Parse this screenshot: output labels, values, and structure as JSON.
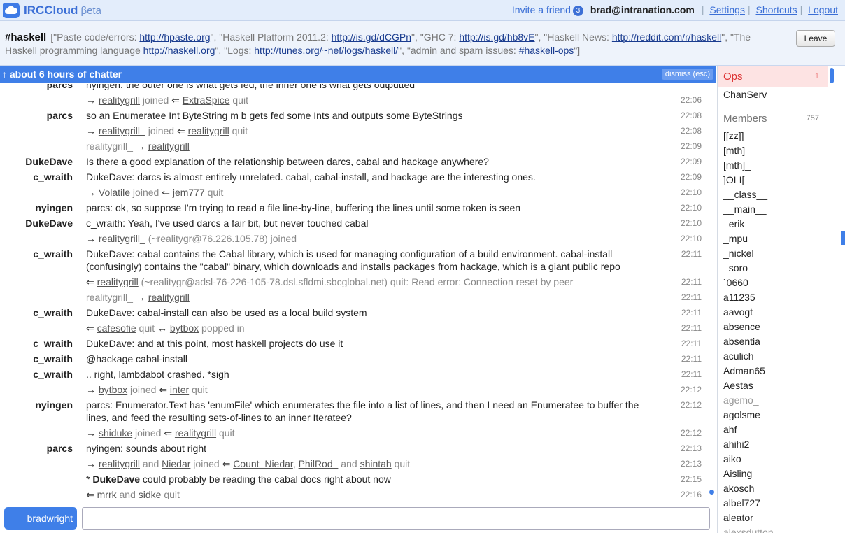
{
  "app": {
    "brand": "IRCCloud",
    "beta": "βeta"
  },
  "header": {
    "invite_label": "Invite a friend",
    "invite_count": "3",
    "user_email": "brad@intranation.com",
    "settings": "Settings",
    "shortcuts": "Shortcuts",
    "logout": "Logout"
  },
  "channel": {
    "name": "#haskell",
    "topic": [
      {
        "t": "[\"Paste code/errors: "
      },
      {
        "l": "http://hpaste.org"
      },
      {
        "t": "\", \"Haskell Platform 2011.2: "
      },
      {
        "l": "http://is.gd/dCGPn"
      },
      {
        "t": "\", \"GHC 7: "
      },
      {
        "l": "http://is.gd/hb8vE"
      },
      {
        "t": "\", \"Haskell News: "
      },
      {
        "l": "http://reddit.com/r/haskell"
      },
      {
        "t": "\", \"The Haskell programming language "
      },
      {
        "l": "http://haskell.org"
      },
      {
        "t": "\", \"Logs: "
      },
      {
        "l": "http://tunes.org/~nef/logs/haskell/"
      },
      {
        "t": "\", \"admin and spam issues: "
      },
      {
        "l": "#haskell-ops"
      },
      {
        "t": "\"]"
      }
    ],
    "leave_label": "Leave"
  },
  "chatter": {
    "label": "↑ about 6 hours of chatter",
    "dismiss": "dismiss (esc)"
  },
  "messages": [
    {
      "nick": "parcs",
      "parts": [
        {
          "t": "nyingen: the outer one is what gets fed, the inner one is what gets outputted"
        }
      ],
      "time": ""
    },
    {
      "sys": true,
      "parts": [
        {
          "a": "→ "
        },
        {
          "l": "realitygrill"
        },
        {
          "t": " joined  "
        },
        {
          "a": "⇐ "
        },
        {
          "l": "ExtraSpice"
        },
        {
          "t": " quit"
        }
      ],
      "time": "22:06"
    },
    {
      "nick": "parcs",
      "parts": [
        {
          "t": "so an Enumeratee Int ByteString m b gets fed some Ints and outputs some ByteStrings"
        }
      ],
      "time": "22:08"
    },
    {
      "sys": true,
      "parts": [
        {
          "a": "→ "
        },
        {
          "l": "realitygrill_"
        },
        {
          "t": " joined  "
        },
        {
          "a": "⇐ "
        },
        {
          "l": "realitygrill"
        },
        {
          "t": " quit"
        }
      ],
      "time": "22:08"
    },
    {
      "sys": true,
      "parts": [
        {
          "t": "realitygrill_ "
        },
        {
          "a": "→ "
        },
        {
          "l": "realitygrill"
        }
      ],
      "time": "22:09"
    },
    {
      "nick": "DukeDave",
      "parts": [
        {
          "t": "Is there a good explanation of the relationship between darcs, cabal and hackage anywhere?"
        }
      ],
      "time": "22:09"
    },
    {
      "nick": "c_wraith",
      "parts": [
        {
          "t": "DukeDave: darcs is almost entirely unrelated.  cabal, cabal-install, and hackage are the interesting ones."
        }
      ],
      "time": "22:09"
    },
    {
      "sys": true,
      "parts": [
        {
          "a": "→ "
        },
        {
          "l": "Volatile"
        },
        {
          "t": " joined  "
        },
        {
          "a": "⇐ "
        },
        {
          "l": "jem777"
        },
        {
          "t": " quit"
        }
      ],
      "time": "22:10"
    },
    {
      "nick": "nyingen",
      "parts": [
        {
          "t": "parcs: ok, so suppose I'm trying to read a file line-by-line, buffering the lines until some token is seen"
        }
      ],
      "time": "22:10"
    },
    {
      "nick": "DukeDave",
      "parts": [
        {
          "t": "c_wraith: Yeah, I've used darcs a fair bit, but never touched cabal"
        }
      ],
      "time": "22:10"
    },
    {
      "sys": true,
      "parts": [
        {
          "a": "→ "
        },
        {
          "l": "realitygrill_"
        },
        {
          "t": " (~realitygr@76.226.105.78) joined"
        }
      ],
      "time": "22:10"
    },
    {
      "nick": "c_wraith",
      "parts": [
        {
          "t": "DukeDave: cabal contains the Cabal library, which is used for managing configuration of a build environment.  cabal-install (confusingly) contains the \"cabal\" binary, which downloads and installs packages from hackage, which is a giant public repo"
        }
      ],
      "time": "22:11"
    },
    {
      "sys": true,
      "parts": [
        {
          "a": "⇐ "
        },
        {
          "l": "realitygrill"
        },
        {
          "t": " (~realitygr@adsl-76-226-105-78.dsl.sfldmi.sbcglobal.net) quit: Read error: Connection reset by peer"
        }
      ],
      "time": "22:11"
    },
    {
      "sys": true,
      "parts": [
        {
          "t": "realitygrill_ "
        },
        {
          "a": "→ "
        },
        {
          "l": "realitygrill"
        }
      ],
      "time": "22:11"
    },
    {
      "nick": "c_wraith",
      "parts": [
        {
          "t": "DukeDave: cabal-install can also be used as a local build system"
        }
      ],
      "time": "22:11"
    },
    {
      "sys": true,
      "parts": [
        {
          "a": "⇐ "
        },
        {
          "l": "cafesofie"
        },
        {
          "t": " quit  "
        },
        {
          "a": "↔ "
        },
        {
          "l": "bytbox"
        },
        {
          "t": " popped in"
        }
      ],
      "time": "22:11"
    },
    {
      "nick": "c_wraith",
      "parts": [
        {
          "t": "DukeDave: and at this point, most haskell projects do use it"
        }
      ],
      "time": "22:11"
    },
    {
      "nick": "c_wraith",
      "parts": [
        {
          "t": "@hackage cabal-install"
        }
      ],
      "time": "22:11"
    },
    {
      "nick": "c_wraith",
      "parts": [
        {
          "t": "..  right, lambdabot crashed.  *sigh"
        }
      ],
      "time": "22:11"
    },
    {
      "sys": true,
      "parts": [
        {
          "a": "→ "
        },
        {
          "l": "bytbox"
        },
        {
          "t": " joined  "
        },
        {
          "a": "⇐ "
        },
        {
          "l": "inter"
        },
        {
          "t": " quit"
        }
      ],
      "time": "22:12"
    },
    {
      "nick": "nyingen",
      "parts": [
        {
          "t": "parcs: Enumerator.Text has 'enumFile' which enumerates the file into a list of lines, and then I need an Enumeratee to buffer the lines, and feed the resulting sets-of-lines to an inner Iteratee?"
        }
      ],
      "time": "22:12"
    },
    {
      "sys": true,
      "parts": [
        {
          "a": "→ "
        },
        {
          "l": "shiduke"
        },
        {
          "t": " joined  "
        },
        {
          "a": "⇐ "
        },
        {
          "l": "realitygrill"
        },
        {
          "t": " quit"
        }
      ],
      "time": "22:12"
    },
    {
      "nick": "parcs",
      "parts": [
        {
          "t": "nyingen: sounds about right"
        }
      ],
      "time": "22:13"
    },
    {
      "sys": true,
      "parts": [
        {
          "a": "→ "
        },
        {
          "l": "realitygrill"
        },
        {
          "t": " and "
        },
        {
          "l": "Niedar"
        },
        {
          "t": " joined  "
        },
        {
          "a": "⇐ "
        },
        {
          "l": "Count_Niedar"
        },
        {
          "t": ", "
        },
        {
          "l": "PhilRod_"
        },
        {
          "t": " and "
        },
        {
          "l": "shintah"
        },
        {
          "t": " quit"
        }
      ],
      "time": "22:13"
    },
    {
      "me": true,
      "parts": [
        {
          "t": "* "
        },
        {
          "b": "DukeDave"
        },
        {
          "t": " could probably be reading the cabal docs right about now"
        }
      ],
      "time": "22:15"
    },
    {
      "sys": true,
      "parts": [
        {
          "a": "⇐ "
        },
        {
          "l": "mrrk"
        },
        {
          "t": " and "
        },
        {
          "l": "sidke"
        },
        {
          "t": " quit"
        }
      ],
      "time": "22:16"
    }
  ],
  "sidebar": {
    "ops_label": "Ops",
    "ops_count": "1",
    "ops": [
      "ChanServ"
    ],
    "members_label": "Members",
    "members_count": "757",
    "members": [
      {
        "n": "[[zz]]"
      },
      {
        "n": "[mth]"
      },
      {
        "n": "[mth]_"
      },
      {
        "n": "]OLI["
      },
      {
        "n": "__class__"
      },
      {
        "n": "__main__"
      },
      {
        "n": "_erik_"
      },
      {
        "n": "_mpu"
      },
      {
        "n": "_nickel"
      },
      {
        "n": "_soro_"
      },
      {
        "n": "`0660"
      },
      {
        "n": "a11235"
      },
      {
        "n": "aavogt"
      },
      {
        "n": "absence"
      },
      {
        "n": "absentia"
      },
      {
        "n": "aculich"
      },
      {
        "n": "Adman65"
      },
      {
        "n": "Aestas"
      },
      {
        "n": "agemo_",
        "away": true
      },
      {
        "n": "agolsme"
      },
      {
        "n": "ahf"
      },
      {
        "n": "ahihi2"
      },
      {
        "n": "aiko"
      },
      {
        "n": "Aisling"
      },
      {
        "n": "akosch"
      },
      {
        "n": "albel727"
      },
      {
        "n": "aleator_"
      },
      {
        "n": "alexsdutton",
        "away": true
      }
    ]
  },
  "input": {
    "nick": "bradwright",
    "value": ""
  }
}
